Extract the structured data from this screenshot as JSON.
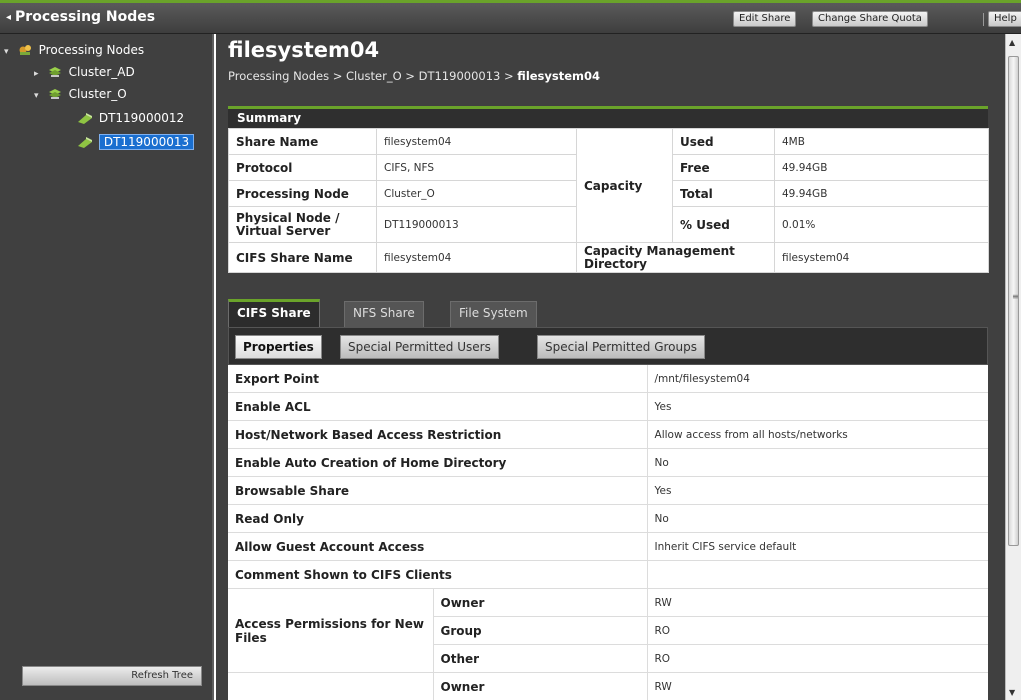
{
  "header": {
    "title": "Processing Nodes",
    "buttons": {
      "edit_share": "Edit Share",
      "change_quota": "Change Share Quota",
      "help": "Help"
    }
  },
  "sidebar": {
    "root": "Processing Nodes",
    "cluster_ad": "Cluster_AD",
    "cluster_o": "Cluster_O",
    "node1": "DT119000012",
    "node2": "DT119000013",
    "refresh": "Refresh Tree"
  },
  "page": {
    "title": "filesystem04",
    "breadcrumb": {
      "p1": "Processing Nodes",
      "p2": "Cluster_O",
      "p3": "DT119000013",
      "current": "filesystem04",
      "sep": " > "
    }
  },
  "summary": {
    "header": "Summary",
    "share_name_label": "Share Name",
    "share_name": "filesystem04",
    "protocol_label": "Protocol",
    "protocol": "CIFS, NFS",
    "processing_node_label": "Processing Node",
    "processing_node": "Cluster_O",
    "physical_node_label": "Physical Node / Virtual Server",
    "physical_node": "DT119000013",
    "cifs_share_name_label": "CIFS Share Name",
    "cifs_share_name": "filesystem04",
    "capacity_label": "Capacity",
    "used_label": "Used",
    "used": "4MB",
    "free_label": "Free",
    "free": "49.94GB",
    "total_label": "Total",
    "total": "49.94GB",
    "pct_used_label": "% Used",
    "pct_used": "0.01%",
    "cap_dir_label": "Capacity Management Directory",
    "cap_dir": "filesystem04"
  },
  "tabs": [
    "CIFS Share",
    "NFS Share",
    "File System"
  ],
  "subtabs": [
    "Properties",
    "Special Permitted Users",
    "Special Permitted Groups"
  ],
  "properties": [
    {
      "label": "Export Point",
      "value": "/mnt/filesystem04"
    },
    {
      "label": "Enable ACL",
      "value": "Yes"
    },
    {
      "label": "Host/Network Based Access Restriction",
      "value": "Allow access from all hosts/networks"
    },
    {
      "label": "Enable Auto Creation of Home Directory",
      "value": "No"
    },
    {
      "label": "Browsable Share",
      "value": "Yes"
    },
    {
      "label": "Read Only",
      "value": "No"
    },
    {
      "label": "Allow Guest Account Access",
      "value": "Inherit CIFS service default"
    },
    {
      "label": "Comment Shown to CIFS Clients",
      "value": ""
    }
  ],
  "access_new_files": {
    "label": "Access Permissions for New Files",
    "owner_label": "Owner",
    "owner": "RW",
    "group_label": "Group",
    "group": "RO",
    "other_label": "Other",
    "other": "RO"
  },
  "partial_row": {
    "owner_label": "Owner",
    "owner": "RW"
  }
}
